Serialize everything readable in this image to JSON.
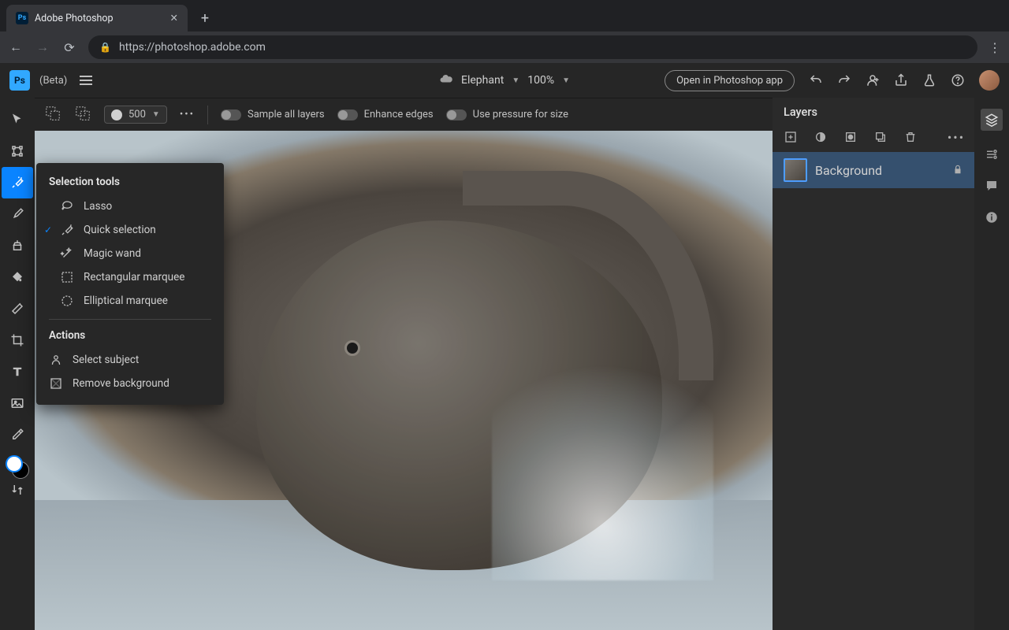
{
  "browser": {
    "tab_title": "Adobe Photoshop",
    "url": "https://photoshop.adobe.com"
  },
  "app": {
    "beta_label": "(Beta)",
    "doc_name": "Elephant",
    "zoom": "100%",
    "open_app_label": "Open in Photoshop app"
  },
  "options": {
    "brush_size": "500",
    "sample_all": "Sample all layers",
    "enhance_edges": "Enhance edges",
    "use_pressure": "Use pressure for size"
  },
  "flyout": {
    "section1": "Selection tools",
    "items": {
      "lasso": "Lasso",
      "quick_selection": "Quick selection",
      "magic_wand": "Magic wand",
      "rect_marquee": "Rectangular marquee",
      "ellip_marquee": "Elliptical marquee"
    },
    "section2": "Actions",
    "actions": {
      "select_subject": "Select subject",
      "remove_bg": "Remove background"
    }
  },
  "layers": {
    "title": "Layers",
    "row0": "Background"
  }
}
